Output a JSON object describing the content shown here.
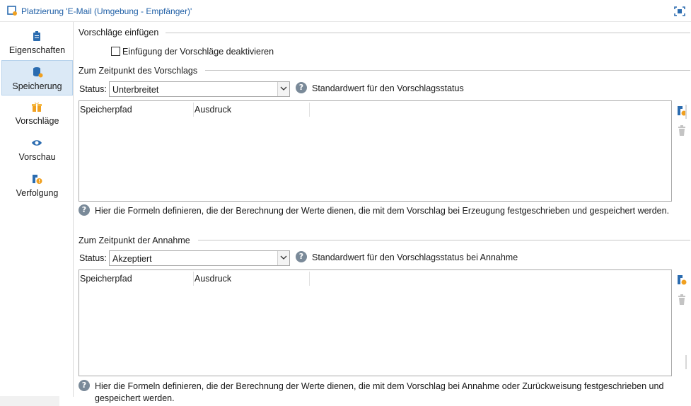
{
  "window": {
    "title": "Platzierung 'E-Mail (Umgebung - Empfänger)'"
  },
  "sidebar": {
    "items": [
      {
        "label": "Eigenschaften",
        "icon": "clipboard-icon",
        "active": false
      },
      {
        "label": "Speicherung",
        "icon": "database-icon",
        "active": true
      },
      {
        "label": "Vorschläge",
        "icon": "gift-icon",
        "active": false
      },
      {
        "label": "Vorschau",
        "icon": "eye-icon",
        "active": false
      },
      {
        "label": "Verfolgung",
        "icon": "tracking-icon",
        "active": false
      }
    ]
  },
  "insert_section": {
    "title": "Vorschläge einfügen",
    "checkbox_label": "Einfügung der Vorschläge deaktivieren",
    "checked": false
  },
  "proposal_section": {
    "title": "Zum Zeitpunkt des Vorschlags",
    "status_label": "Status:",
    "status_value": "Unterbreitet",
    "status_help": "Standardwert für den Vorschlagsstatus",
    "columns": [
      "Speicherpfad",
      "Ausdruck"
    ],
    "help_text": "Hier die Formeln definieren, die der Berechnung der Werte dienen, die mit dem Vorschlag bei Erzeugung festgeschrieben und gespeichert werden."
  },
  "acceptance_section": {
    "title": "Zum Zeitpunkt der Annahme",
    "status_label": "Status:",
    "status_value": "Akzeptiert",
    "status_help": "Standardwert für den Vorschlagsstatus bei Annahme",
    "columns": [
      "Speicherpfad",
      "Ausdruck"
    ],
    "help_text": "Hier die Formeln definieren, die der Berechnung der Werte dienen, die mit dem Vorschlag bei Annahme oder Zurückweisung festgeschrieben und gespeichert werden."
  },
  "colors": {
    "accent": "#1f5fa6",
    "active_bg": "#dbe9f6",
    "icon_blue": "#2b6cb0",
    "icon_orange": "#f0a020"
  }
}
